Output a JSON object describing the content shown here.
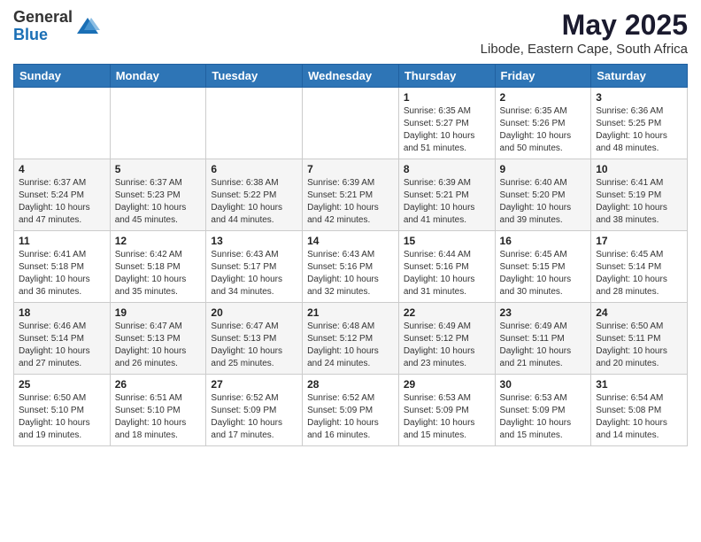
{
  "header": {
    "logo_line1": "General",
    "logo_line2": "Blue",
    "title": "May 2025",
    "subtitle": "Libode, Eastern Cape, South Africa"
  },
  "days_of_week": [
    "Sunday",
    "Monday",
    "Tuesday",
    "Wednesday",
    "Thursday",
    "Friday",
    "Saturday"
  ],
  "weeks": [
    [
      {
        "num": "",
        "info": ""
      },
      {
        "num": "",
        "info": ""
      },
      {
        "num": "",
        "info": ""
      },
      {
        "num": "",
        "info": ""
      },
      {
        "num": "1",
        "info": "Sunrise: 6:35 AM\nSunset: 5:27 PM\nDaylight: 10 hours\nand 51 minutes."
      },
      {
        "num": "2",
        "info": "Sunrise: 6:35 AM\nSunset: 5:26 PM\nDaylight: 10 hours\nand 50 minutes."
      },
      {
        "num": "3",
        "info": "Sunrise: 6:36 AM\nSunset: 5:25 PM\nDaylight: 10 hours\nand 48 minutes."
      }
    ],
    [
      {
        "num": "4",
        "info": "Sunrise: 6:37 AM\nSunset: 5:24 PM\nDaylight: 10 hours\nand 47 minutes."
      },
      {
        "num": "5",
        "info": "Sunrise: 6:37 AM\nSunset: 5:23 PM\nDaylight: 10 hours\nand 45 minutes."
      },
      {
        "num": "6",
        "info": "Sunrise: 6:38 AM\nSunset: 5:22 PM\nDaylight: 10 hours\nand 44 minutes."
      },
      {
        "num": "7",
        "info": "Sunrise: 6:39 AM\nSunset: 5:21 PM\nDaylight: 10 hours\nand 42 minutes."
      },
      {
        "num": "8",
        "info": "Sunrise: 6:39 AM\nSunset: 5:21 PM\nDaylight: 10 hours\nand 41 minutes."
      },
      {
        "num": "9",
        "info": "Sunrise: 6:40 AM\nSunset: 5:20 PM\nDaylight: 10 hours\nand 39 minutes."
      },
      {
        "num": "10",
        "info": "Sunrise: 6:41 AM\nSunset: 5:19 PM\nDaylight: 10 hours\nand 38 minutes."
      }
    ],
    [
      {
        "num": "11",
        "info": "Sunrise: 6:41 AM\nSunset: 5:18 PM\nDaylight: 10 hours\nand 36 minutes."
      },
      {
        "num": "12",
        "info": "Sunrise: 6:42 AM\nSunset: 5:18 PM\nDaylight: 10 hours\nand 35 minutes."
      },
      {
        "num": "13",
        "info": "Sunrise: 6:43 AM\nSunset: 5:17 PM\nDaylight: 10 hours\nand 34 minutes."
      },
      {
        "num": "14",
        "info": "Sunrise: 6:43 AM\nSunset: 5:16 PM\nDaylight: 10 hours\nand 32 minutes."
      },
      {
        "num": "15",
        "info": "Sunrise: 6:44 AM\nSunset: 5:16 PM\nDaylight: 10 hours\nand 31 minutes."
      },
      {
        "num": "16",
        "info": "Sunrise: 6:45 AM\nSunset: 5:15 PM\nDaylight: 10 hours\nand 30 minutes."
      },
      {
        "num": "17",
        "info": "Sunrise: 6:45 AM\nSunset: 5:14 PM\nDaylight: 10 hours\nand 28 minutes."
      }
    ],
    [
      {
        "num": "18",
        "info": "Sunrise: 6:46 AM\nSunset: 5:14 PM\nDaylight: 10 hours\nand 27 minutes."
      },
      {
        "num": "19",
        "info": "Sunrise: 6:47 AM\nSunset: 5:13 PM\nDaylight: 10 hours\nand 26 minutes."
      },
      {
        "num": "20",
        "info": "Sunrise: 6:47 AM\nSunset: 5:13 PM\nDaylight: 10 hours\nand 25 minutes."
      },
      {
        "num": "21",
        "info": "Sunrise: 6:48 AM\nSunset: 5:12 PM\nDaylight: 10 hours\nand 24 minutes."
      },
      {
        "num": "22",
        "info": "Sunrise: 6:49 AM\nSunset: 5:12 PM\nDaylight: 10 hours\nand 23 minutes."
      },
      {
        "num": "23",
        "info": "Sunrise: 6:49 AM\nSunset: 5:11 PM\nDaylight: 10 hours\nand 21 minutes."
      },
      {
        "num": "24",
        "info": "Sunrise: 6:50 AM\nSunset: 5:11 PM\nDaylight: 10 hours\nand 20 minutes."
      }
    ],
    [
      {
        "num": "25",
        "info": "Sunrise: 6:50 AM\nSunset: 5:10 PM\nDaylight: 10 hours\nand 19 minutes."
      },
      {
        "num": "26",
        "info": "Sunrise: 6:51 AM\nSunset: 5:10 PM\nDaylight: 10 hours\nand 18 minutes."
      },
      {
        "num": "27",
        "info": "Sunrise: 6:52 AM\nSunset: 5:09 PM\nDaylight: 10 hours\nand 17 minutes."
      },
      {
        "num": "28",
        "info": "Sunrise: 6:52 AM\nSunset: 5:09 PM\nDaylight: 10 hours\nand 16 minutes."
      },
      {
        "num": "29",
        "info": "Sunrise: 6:53 AM\nSunset: 5:09 PM\nDaylight: 10 hours\nand 15 minutes."
      },
      {
        "num": "30",
        "info": "Sunrise: 6:53 AM\nSunset: 5:09 PM\nDaylight: 10 hours\nand 15 minutes."
      },
      {
        "num": "31",
        "info": "Sunrise: 6:54 AM\nSunset: 5:08 PM\nDaylight: 10 hours\nand 14 minutes."
      }
    ]
  ]
}
